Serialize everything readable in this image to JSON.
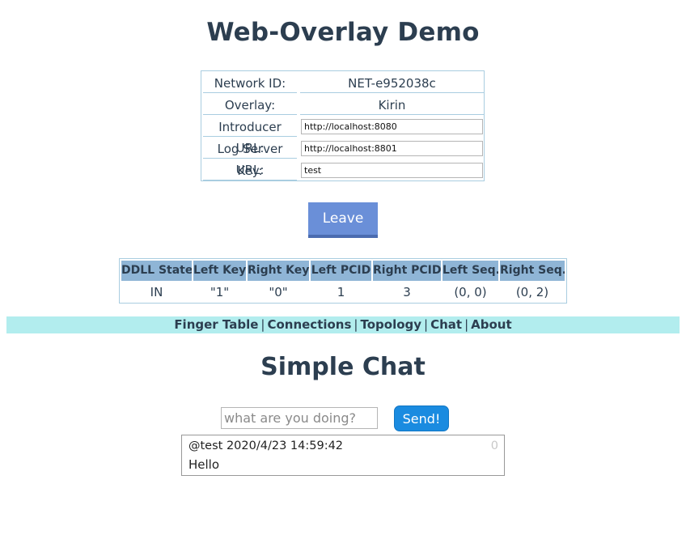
{
  "page": {
    "title": "Web-Overlay Demo"
  },
  "info": {
    "network_label": "Network ID:",
    "network_value": "NET-e952038c",
    "overlay_label": "Overlay:",
    "overlay_value": "Kirin",
    "introducer_label": "Introducer URL:",
    "introducer_value": "http://localhost:8080",
    "logserver_label": "Log Server URL:",
    "logserver_value": "http://localhost:8801",
    "key_label": "Key:",
    "key_value": "test"
  },
  "actions": {
    "leave_label": "Leave"
  },
  "ddll": {
    "headers": [
      "DDLL State",
      "Left Key",
      "Right Key",
      "Left PCID",
      "Right PCID",
      "Left Seq.",
      "Right Seq."
    ],
    "row": [
      "IN",
      "\"1\"",
      "\"0\"",
      "1",
      "3",
      "(0, 0)",
      "(0, 2)"
    ]
  },
  "nav": {
    "items": [
      "Finger Table",
      "Connections",
      "Topology",
      "Chat",
      "About"
    ],
    "separator": "|"
  },
  "chat": {
    "title": "Simple Chat",
    "input_placeholder": "what are you doing?",
    "input_value": "",
    "send_label": "Send!",
    "messages": [
      {
        "meta": "@test 2020/4/23 14:59:42",
        "text": "Hello",
        "count": "0"
      }
    ]
  },
  "colors": {
    "text": "#2c3e50",
    "table_border": "#a9cde0",
    "table_header": "#8fb5d6",
    "nav_bg": "#b2edee",
    "leave_button": "#6a8fd8",
    "send_button": "#1a8be0"
  }
}
